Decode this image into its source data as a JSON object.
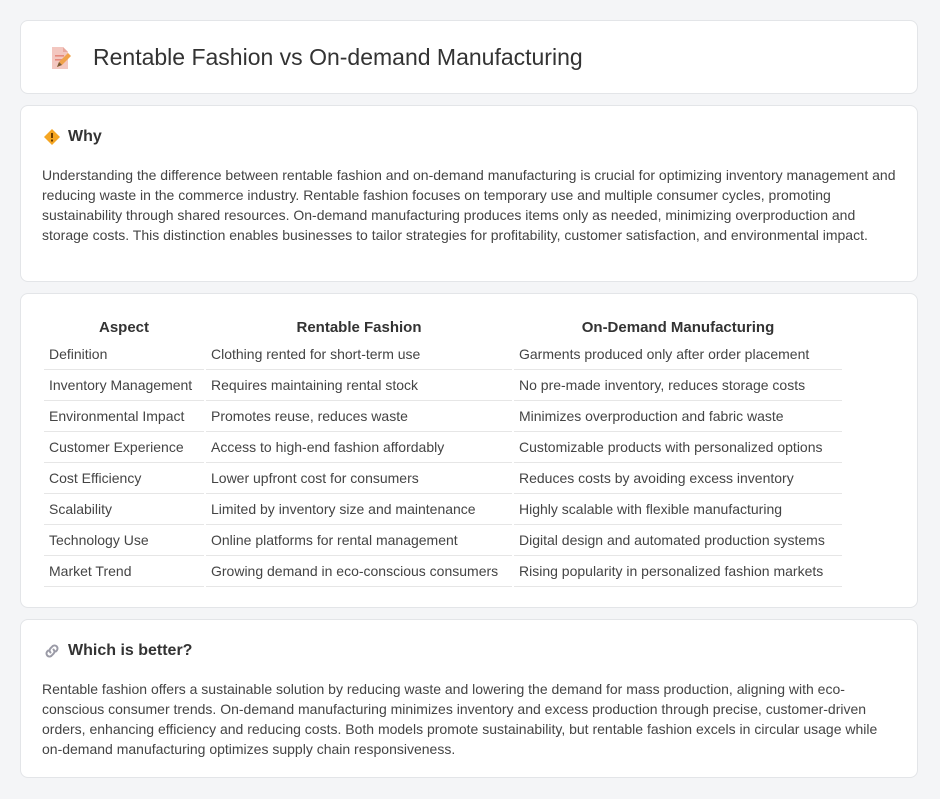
{
  "page": {
    "title": "Rentable Fashion vs On-demand Manufacturing",
    "title_icon": "edit-document-icon"
  },
  "why": {
    "icon": "diamond-sign-icon",
    "heading": "Why",
    "body": "Understanding the difference between rentable fashion and on-demand manufacturing is crucial for optimizing inventory management and reducing waste in the commerce industry. Rentable fashion focuses on temporary use and multiple consumer cycles, promoting sustainability through shared resources. On-demand manufacturing produces items only as needed, minimizing overproduction and storage costs. This distinction enables businesses to tailor strategies for profitability, customer satisfaction, and environmental impact."
  },
  "table": {
    "headers": [
      "Aspect",
      "Rentable Fashion",
      "On-Demand Manufacturing"
    ],
    "rows": [
      [
        "Definition",
        "Clothing rented for short-term use",
        "Garments produced only after order placement"
      ],
      [
        "Inventory Management",
        "Requires maintaining rental stock",
        "No pre-made inventory, reduces storage costs"
      ],
      [
        "Environmental Impact",
        "Promotes reuse, reduces waste",
        "Minimizes overproduction and fabric waste"
      ],
      [
        "Customer Experience",
        "Access to high-end fashion affordably",
        "Customizable products with personalized options"
      ],
      [
        "Cost Efficiency",
        "Lower upfront cost for consumers",
        "Reduces costs by avoiding excess inventory"
      ],
      [
        "Scalability",
        "Limited by inventory size and maintenance",
        "Highly scalable with flexible manufacturing"
      ],
      [
        "Technology Use",
        "Online platforms for rental management",
        "Digital design and automated production systems"
      ],
      [
        "Market Trend",
        "Growing demand in eco-conscious consumers",
        "Rising popularity in personalized fashion markets"
      ]
    ]
  },
  "better": {
    "icon": "link-icon",
    "heading": "Which is better?",
    "body": "Rentable fashion offers a sustainable solution by reducing waste and lowering the demand for mass production, aligning with eco-conscious consumer trends. On-demand manufacturing minimizes inventory and excess production through precise, customer-driven orders, enhancing efficiency and reducing costs. Both models promote sustainability, but rentable fashion excels in circular usage while on-demand manufacturing optimizes supply chain responsiveness."
  }
}
